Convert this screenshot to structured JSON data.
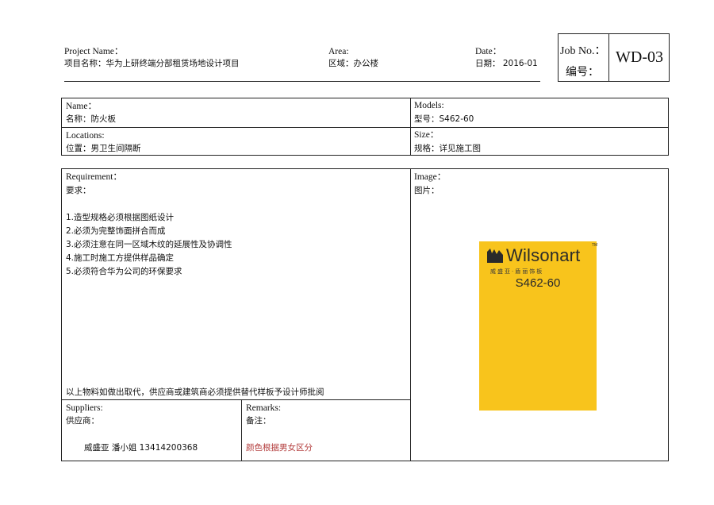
{
  "header": {
    "project_en": "Project Name：",
    "project_cn": "项目名称：华为上研终端分部租赁场地设计项目",
    "area_en": "Area:",
    "area_cn": "区域：办公楼",
    "date_en": "Date：",
    "date_cn": "日期：  2016-01",
    "job_en": "Job No.：",
    "job_cn": "编号：",
    "job_value": "WD-03"
  },
  "info": {
    "name_en": "Name：",
    "name_cn": "名称：防火板",
    "models_en": "Models:",
    "models_cn": "型号：S462-60",
    "locations_en": "Locations:",
    "locations_cn": "位置：男卫生间隔断",
    "size_en": "Size：",
    "size_cn": "规格：详见施工图"
  },
  "requirement": {
    "label_en": "Requirement：",
    "label_cn": "要求：",
    "items": [
      "1.造型规格必须根据图纸设计",
      "2.必须为完整饰面拼合而成",
      "3.必须注意在同一区域木纹的延展性及协调性",
      "4.施工时施工方提供样品确定",
      "5.必须符合华为公司的环保要求"
    ],
    "footnote": "以上物料如做出取代，供应商或建筑商必须提供替代样板予设计师批阅"
  },
  "image": {
    "label_en": "Image：",
    "label_cn": "图片：",
    "brand": "Wilsonart",
    "brand_tm": "TM",
    "brand_cn": "威盛亚·盾丽饰板",
    "code": "S462-60",
    "swatch_color": "#f8c41c"
  },
  "suppliers": {
    "label_en": "Suppliers:",
    "label_cn": "供应商：",
    "value": "威盛亚  潘小姐  13414200368"
  },
  "remarks": {
    "label_en": "Remarks:",
    "label_cn": "备注：",
    "value": "颜色根据男女区分"
  }
}
